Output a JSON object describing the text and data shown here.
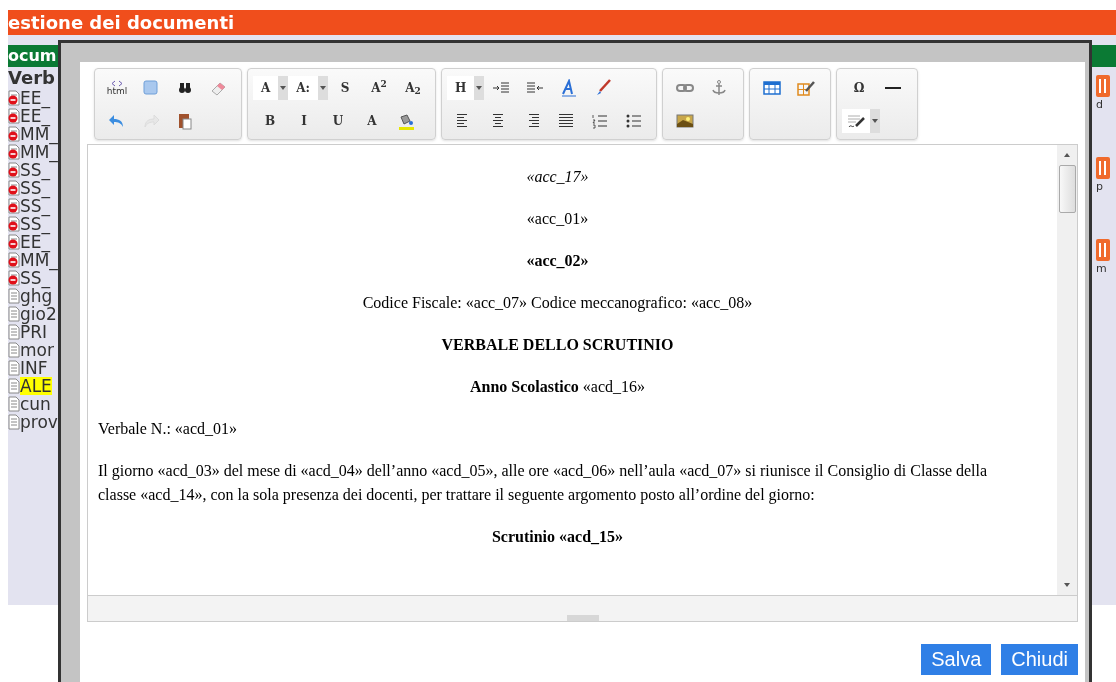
{
  "page": {
    "title": "estione dei documenti",
    "section": "ocum",
    "list_title": "Verb",
    "items": [
      {
        "label": "EE_",
        "kind": "blocked",
        "selected": false
      },
      {
        "label": "EE_",
        "kind": "blocked",
        "selected": false
      },
      {
        "label": "MM_",
        "kind": "blocked",
        "selected": false
      },
      {
        "label": "MM_",
        "kind": "blocked",
        "selected": false
      },
      {
        "label": "SS_",
        "kind": "blocked",
        "selected": false
      },
      {
        "label": "SS_",
        "kind": "blocked",
        "selected": false
      },
      {
        "label": "SS_",
        "kind": "blocked",
        "selected": false
      },
      {
        "label": "SS_",
        "kind": "blocked",
        "selected": false
      },
      {
        "label": "EE_",
        "kind": "blocked",
        "selected": false
      },
      {
        "label": "MM_",
        "kind": "blocked",
        "selected": false
      },
      {
        "label": "SS_",
        "kind": "blocked",
        "selected": false
      },
      {
        "label": "ghg",
        "kind": "plain",
        "selected": false
      },
      {
        "label": "gio2",
        "kind": "plain",
        "selected": false
      },
      {
        "label": "PRI",
        "kind": "plain",
        "selected": false
      },
      {
        "label": "mor",
        "kind": "plain",
        "selected": false
      },
      {
        "label": "INF",
        "kind": "plain",
        "selected": false
      },
      {
        "label": "ALE",
        "kind": "plain",
        "selected": true
      },
      {
        "label": "cun",
        "kind": "plain",
        "selected": false
      },
      {
        "label": "prov",
        "kind": "plain",
        "selected": false
      }
    ],
    "side_actions": [
      "d",
      "p",
      "m"
    ]
  },
  "editor": {
    "toolbar": [
      {
        "rows": [
          [
            {
              "kind": "code",
              "label": "html",
              "disabled": false
            },
            {
              "kind": "icon",
              "disabled": false
            },
            {
              "kind": "icon",
              "disabled": false
            },
            {
              "kind": "icon",
              "disabled": false
            }
          ],
          [
            {
              "kind": "icon",
              "disabled": false
            },
            {
              "kind": "icon",
              "disabled": true
            },
            {
              "kind": "icon",
              "disabled": false
            }
          ]
        ]
      },
      {
        "rows": [
          [
            {
              "kind": "dropdown",
              "label": "A",
              "disabled": false
            },
            {
              "kind": "dropdown",
              "label": "A:",
              "disabled": false
            },
            {
              "kind": "glyph",
              "label": "S",
              "disabled": false
            },
            {
              "kind": "glyph",
              "label": "A$^{2}$",
              "disabled": false
            },
            {
              "kind": "glyph",
              "label": "A$_{2}$",
              "disabled": false
            }
          ],
          [
            {
              "kind": "glyph",
              "label": "B",
              "disabled": false
            },
            {
              "kind": "glyph",
              "label": "I",
              "disabled": false
            },
            {
              "kind": "glyph",
              "label": "U",
              "disabled": false
            },
            {
              "kind": "glyph",
              "label": "A",
              "disabled": false
            },
            {
              "kind": "icon",
              "disabled": false
            }
          ]
        ]
      },
      {
        "rows": [
          [
            {
              "kind": "dropdown",
              "label": "H",
              "disabled": false
            },
            {
              "kind": "icon",
              "disabled": false
            },
            {
              "kind": "icon",
              "disabled": false
            },
            {
              "kind": "icon",
              "disabled": false
            },
            {
              "kind": "icon",
              "disabled": false
            }
          ],
          [
            {
              "kind": "icon",
              "disabled": false
            },
            {
              "kind": "icon",
              "disabled": false
            },
            {
              "kind": "icon",
              "disabled": false
            },
            {
              "kind": "icon",
              "disabled": false
            },
            {
              "kind": "icon",
              "disabled": false
            },
            {
              "kind": "icon",
              "disabled": false
            }
          ]
        ]
      },
      {
        "rows": [
          [
            {
              "kind": "icon",
              "disabled": false
            },
            {
              "kind": "icon",
              "disabled": false
            }
          ],
          [
            {
              "kind": "icon",
              "disabled": false
            }
          ]
        ]
      },
      {
        "rows": [
          [
            {
              "kind": "icon",
              "disabled": false
            },
            {
              "kind": "icon",
              "disabled": false
            }
          ],
          []
        ]
      },
      {
        "rows": [
          [
            {
              "kind": "glyph",
              "label": "Ω",
              "disabled": false
            },
            {
              "kind": "icon",
              "disabled": false
            }
          ],
          [
            {
              "kind": "icon-dropdown",
              "disabled": false
            }
          ]
        ]
      }
    ],
    "paragraphs": [
      {
        "text": "«acc_17»",
        "kind": "caption"
      },
      {
        "text": "«acc_01»",
        "kind": "centered"
      },
      {
        "text": "«acc_02»",
        "kind": "heading"
      },
      {
        "text": "Codice Fiscale: «acc_07» Codice meccanografico: «acc_08»",
        "kind": "centered"
      },
      {
        "text": "VERBALE DELLO SCRUTINIO",
        "kind": "heading"
      },
      {
        "text": "**Anno Scolastico** «acd_16»",
        "kind": "centered"
      },
      {
        "text": "Verbale N.: «acd_01»",
        "kind": "body"
      },
      {
        "text": "Il giorno «acd_03» del mese di «acd_04» dell’anno «acd_05», alle ore «acd_06» nell’aula «acd_07» si riunisce il Consiglio di Classe della classe «acd_14», con la sola presenza dei docenti, per trattare il seguente argomento posto all’ordine del giorno:",
        "kind": "body"
      },
      {
        "text": "Scrutinio «acd_15»",
        "kind": "heading"
      }
    ]
  },
  "buttons": [
    "Salva",
    "Chiudi"
  ]
}
